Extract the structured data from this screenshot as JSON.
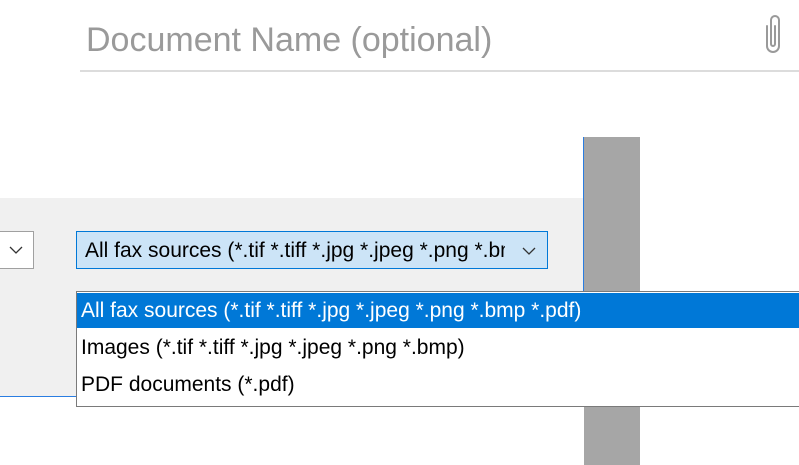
{
  "document": {
    "name_placeholder": "Document Name (optional)",
    "name_value": "",
    "attach_icon": "paperclip-icon"
  },
  "file_dialog": {
    "left_combo_icon": "chevron-down-icon",
    "file_type": {
      "selected_label": "All fax sources (*.tif *.tiff *.jpg *.jpeg *.png *.bmp *.pdf)",
      "dropdown_icon": "chevron-down-icon",
      "options": [
        "All fax sources (*.tif *.tiff *.jpg *.jpeg *.png *.bmp *.pdf)",
        "Images (*.tif *.tiff *.jpg *.jpeg *.png *.bmp)",
        "PDF documents (*.pdf)"
      ],
      "highlighted_index": 0
    }
  },
  "colors": {
    "accent": "#0078d7",
    "selection_bg": "#0078d7",
    "combo_bg": "#cce4f7",
    "panel_bg": "#f0f0f0",
    "side_bar": "#a6a6a6",
    "underline": "#dcdcdc"
  }
}
